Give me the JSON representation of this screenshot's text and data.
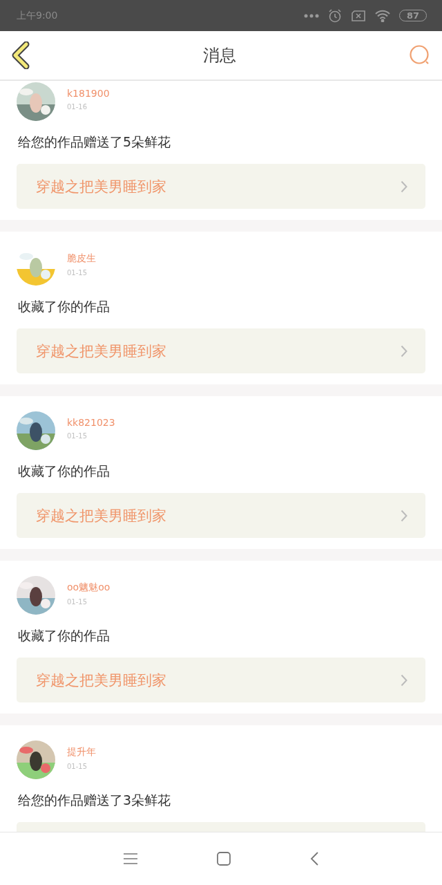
{
  "status_bar": {
    "time": "上午9:00",
    "battery": "87"
  },
  "header": {
    "title": "消息"
  },
  "messages": [
    {
      "user": "k181900",
      "date": "01-16",
      "text": "给您的作品赠送了5朵鲜花",
      "work_title": "穿越之把美男睡到家"
    },
    {
      "user": "脆皮生",
      "date": "01-15",
      "text": "收藏了你的作品",
      "work_title": "穿越之把美男睡到家"
    },
    {
      "user": "kk821023",
      "date": "01-15",
      "text": "收藏了你的作品",
      "work_title": "穿越之把美男睡到家"
    },
    {
      "user": "oo魑魅oo",
      "date": "01-15",
      "text": "收藏了你的作品",
      "work_title": "穿越之把美男睡到家"
    },
    {
      "user": "提升年",
      "date": "01-15",
      "text": "给您的作品赠送了3朵鲜花"
    }
  ]
}
